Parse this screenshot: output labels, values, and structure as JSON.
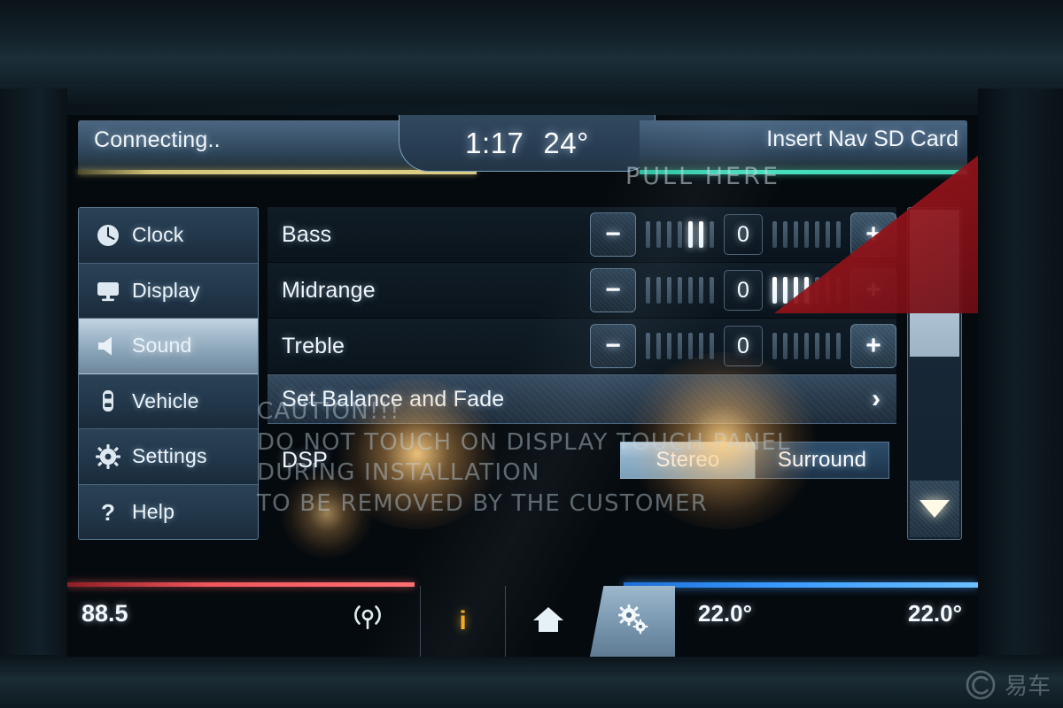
{
  "statusbar": {
    "connection_status": "Connecting..",
    "time": "1:17",
    "exterior_temp": "24°",
    "nav_message": "Insert Nav SD Card",
    "accent_left": "#e3d48a",
    "accent_right": "#49e0bd"
  },
  "sidebar": {
    "items": [
      {
        "label": "Clock",
        "icon": "clock-icon",
        "selected": false
      },
      {
        "label": "Display",
        "icon": "monitor-icon",
        "selected": false
      },
      {
        "label": "Sound",
        "icon": "speaker-icon",
        "selected": true
      },
      {
        "label": "Vehicle",
        "icon": "car-icon",
        "selected": false
      },
      {
        "label": "Settings",
        "icon": "gear-icon",
        "selected": false
      },
      {
        "label": "Help",
        "icon": "question-icon",
        "selected": false
      }
    ]
  },
  "sound_settings": {
    "rows": [
      {
        "label": "Bass",
        "value": "0",
        "minus_label": "−",
        "plus_label": "+",
        "left_ticks": 7,
        "left_lit_from": 5,
        "right_ticks": 7,
        "right_lit_to": 0
      },
      {
        "label": "Midrange",
        "value": "0",
        "minus_label": "−",
        "plus_label": "+",
        "left_ticks": 7,
        "left_lit_from": 7,
        "right_ticks": 7,
        "right_lit_to": 4
      },
      {
        "label": "Treble",
        "value": "0",
        "minus_label": "−",
        "plus_label": "+",
        "left_ticks": 7,
        "left_lit_from": 7,
        "right_ticks": 7,
        "right_lit_to": 0
      }
    ],
    "balance_fade": {
      "label": "Set Balance and Fade",
      "chevron": "›"
    },
    "dsp": {
      "label": "DSP",
      "options": [
        {
          "label": "Stereo",
          "selected": true
        },
        {
          "label": "Surround",
          "selected": false
        }
      ]
    }
  },
  "scrollbar": {
    "down_arrow": "▼"
  },
  "bottombar": {
    "radio_frequency": "88.5",
    "signal_icon": "broadcast-icon",
    "info_icon": "info-icon",
    "home_icon": "home-icon",
    "settings_icon": "gears-icon",
    "temp_left": "22.0°",
    "temp_right": "22.0°",
    "accent_left": "#f0565c",
    "accent_right": "#3b9bff"
  },
  "protective_film": {
    "pull_tab_label": "PULL HERE",
    "caution_lines": [
      "CAUTION!!!",
      "DO NOT TOUCH ON DISPLAY TOUCH PANEL",
      "DURING INSTALLATION",
      "TO BE REMOVED BY THE CUSTOMER"
    ],
    "tab_color": "#8e1219"
  },
  "watermark": {
    "text": "易车"
  }
}
